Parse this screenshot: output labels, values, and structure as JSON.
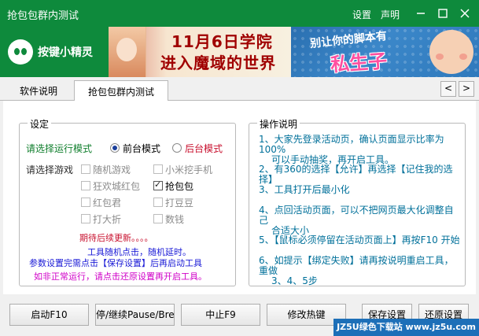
{
  "window": {
    "title": "抢包包群内测试",
    "settings_link": "设置",
    "statement_link": "声明"
  },
  "banner": {
    "logo_text": "按键小精灵",
    "ad_line1": "11月6日学院",
    "ad_line2": "进入魔域的世界",
    "ad_right_line1": "别让你的脚本有",
    "ad_right_line2": "私生子"
  },
  "tabs": [
    {
      "label": "软件说明"
    },
    {
      "label": "抢包包群内测试"
    }
  ],
  "tab_arrows": {
    "left": "<",
    "right": ">"
  },
  "settings": {
    "legend": "设定",
    "mode_label": "请选择运行模式",
    "mode_foreground": "前台模式",
    "mode_background": "后台模式",
    "game_label": "请选择游戏",
    "games": [
      {
        "label": "随机游戏",
        "checked": false
      },
      {
        "label": "小米挖手机",
        "checked": false
      },
      {
        "label": "狂欢城红包",
        "checked": false
      },
      {
        "label": "抢包包",
        "checked": true
      },
      {
        "label": "红包君",
        "checked": false
      },
      {
        "label": "打豆豆",
        "checked": false
      },
      {
        "label": "打大折",
        "checked": false
      },
      {
        "label": "数钱",
        "checked": false
      }
    ],
    "note1": "期待后续更新。。。。",
    "note2": "工具随机点击，随机延时。",
    "note3": "参数设置完需点击【保存设置】后再启动工具",
    "note4": "如非正常运行，请点击还原设置再开启工具。"
  },
  "ops": {
    "legend": "操作说明",
    "items": [
      {
        "line1": "1、大家先登录活动页，确认页面显示比率为100%",
        "line2": "可以手动抽奖，再开启工具。"
      },
      {
        "line1": "2、有360的选择【允许】再选择【记住我的选择】",
        "line2": ""
      },
      {
        "line1": "3、工具打开后最小化",
        "line2": ""
      },
      {
        "line1": "4、点回活动页面，可以不把网页最大化调整自己",
        "line2": "合适大小"
      },
      {
        "line1": "5、【鼠标必须停留在活动页面上】再按F10 开始",
        "line2": ""
      },
      {
        "line1": "6、如提示【绑定失败】请再按说明重启工具，重做",
        "line2": "3、4、5步"
      }
    ]
  },
  "buttons": {
    "start": "启动F10",
    "pause": "停/继续Pause/Break",
    "stop": "中止F9",
    "hotkey": "修改热键",
    "save": "保存设置",
    "restore": "还原设置"
  },
  "watermark": "JZ5U绿色下载站 www.jz5u.com",
  "colors": {
    "title_bar": "#0e8a3c",
    "mode_label": "#0f7e2c",
    "background_mode": "#c8102e",
    "note_red": "#c8102e",
    "note_blue": "#1a1ad6",
    "note_magenta": "#d000c8",
    "ops_text": "#00709a"
  }
}
